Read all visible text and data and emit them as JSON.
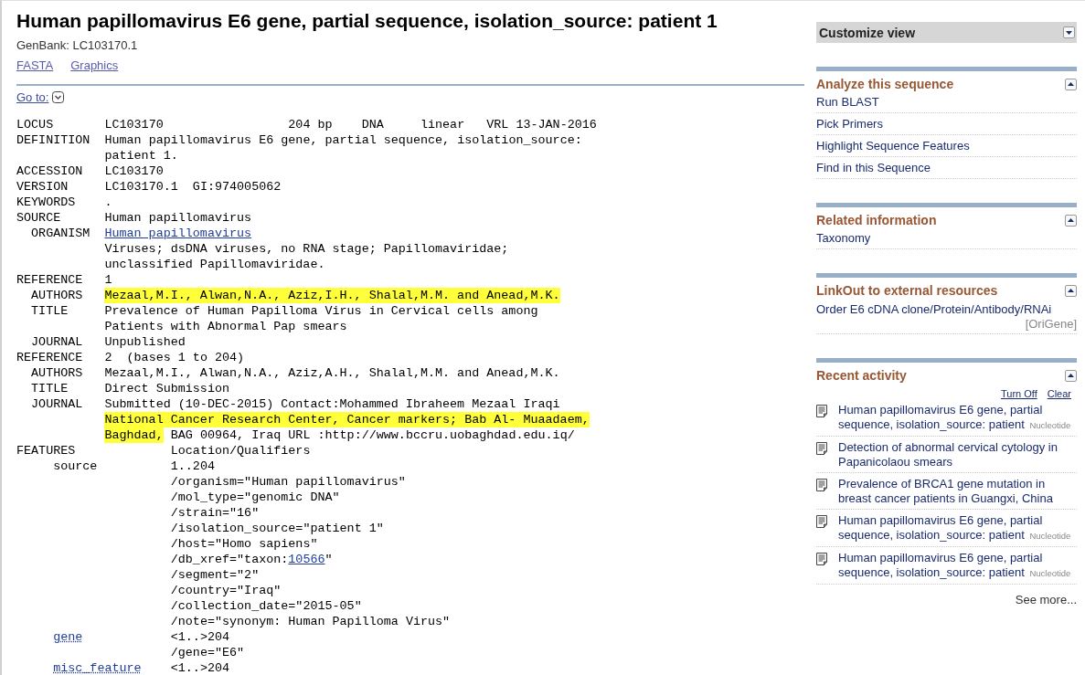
{
  "header": {
    "title": "Human papillomavirus E6 gene, partial sequence, isolation_source: patient 1",
    "accession": "GenBank: LC103170.1",
    "links": [
      "FASTA",
      "Graphics"
    ],
    "goto": "Go to:"
  },
  "records": [
    {
      "label": "LOCUS",
      "lines": [
        "LC103170                 204 bp    DNA     linear   VRL 13-JAN-2016"
      ]
    },
    {
      "label": "DEFINITION",
      "lines": [
        "Human papillomavirus E6 gene, partial sequence, isolation_source:",
        "patient 1."
      ]
    },
    {
      "label": "ACCESSION",
      "lines": [
        "LC103170"
      ]
    },
    {
      "label": "VERSION",
      "lines": [
        "LC103170.1  GI:974005062"
      ]
    },
    {
      "label": "KEYWORDS",
      "lines": [
        "."
      ]
    },
    {
      "label": "SOURCE",
      "lines": [
        "Human papillomavirus"
      ],
      "children": [
        {
          "label": "ORGANISM",
          "lines": [
            [
              {
                "kind": "link",
                "text": "Human papillomavirus"
              }
            ],
            "Viruses; dsDNA viruses, no RNA stage; Papillomaviridae;",
            "unclassified Papillomaviridae."
          ]
        }
      ]
    },
    {
      "label": "REFERENCE",
      "lines": [
        "1"
      ],
      "children": [
        {
          "label": "AUTHORS",
          "lines": [
            [
              {
                "kind": "highlight",
                "text": "Mezaal,M.I., Alwan,N.A., Aziz,I.H., Shalal,M.M. and Anead,M.K."
              }
            ]
          ]
        },
        {
          "label": "TITLE",
          "lines": [
            "Prevalence of Human Papilloma Virus in Cervical cells among",
            "Patients with Abnormal Pap smears"
          ]
        },
        {
          "label": "JOURNAL",
          "lines": [
            "Unpublished"
          ]
        }
      ]
    },
    {
      "label": "REFERENCE",
      "lines": [
        "2  (bases 1 to 204)"
      ],
      "children": [
        {
          "label": "AUTHORS",
          "lines": [
            "Mezaal,M.I., Alwan,N.A., Aziz,A.H., Shalal,M.M. and Anead,M.K."
          ]
        },
        {
          "label": "TITLE",
          "lines": [
            "Direct Submission"
          ]
        },
        {
          "label": "JOURNAL",
          "lines": [
            "Submitted (10-DEC-2015) Contact:Mohammed Ibraheem Mezaal Iraqi",
            [
              {
                "kind": "highlight",
                "text": "National Cancer Research Center, Cancer markers; Bab Al- Muaadaem,"
              }
            ],
            [
              {
                "kind": "highlight",
                "text": "Baghdad,"
              },
              {
                "kind": "plain",
                "text": " BAG 00964, Iraq URL :http://www.bccru.uobaghdad.edu.iq/"
              }
            ]
          ]
        }
      ]
    }
  ],
  "features": {
    "label": "FEATURES",
    "heading": "Location/Qualifiers",
    "items": [
      {
        "key": {
          "text": "source",
          "kind": "plain"
        },
        "lines": [
          "1..204",
          "/organism=\"Human papillomavirus\"",
          "/mol_type=\"genomic DNA\"",
          "/strain=\"16\"",
          "/isolation_source=\"patient 1\"",
          "/host=\"Homo sapiens\"",
          [
            {
              "kind": "plain",
              "text": "/db_xref=\"taxon:"
            },
            {
              "kind": "link",
              "text": "10566"
            },
            {
              "kind": "plain",
              "text": "\""
            }
          ],
          "/segment=\"2\"",
          "/country=\"Iraq\"",
          "/collection_date=\"2015-05\"",
          "/note=\"synonym: Human Papilloma Virus\""
        ]
      },
      {
        "key": {
          "text": "gene",
          "kind": "link"
        },
        "lines": [
          "<1..>204",
          "/gene=\"E6\""
        ]
      },
      {
        "key": {
          "text": "misc_feature",
          "kind": "link"
        },
        "lines": [
          "<1..>204"
        ]
      }
    ]
  },
  "sidebar": {
    "customize": {
      "title": "Customize view",
      "expanded": false
    },
    "portlets": [
      {
        "kind": "links",
        "title": "Analyze this sequence",
        "expanded": true,
        "links": [
          "Run BLAST",
          "Pick Primers",
          "Highlight Sequence Features",
          "Find in this Sequence"
        ]
      },
      {
        "kind": "links",
        "title": "Related information",
        "expanded": true,
        "links": [
          "Taxonomy"
        ]
      },
      {
        "kind": "linkout",
        "title": "LinkOut to external resources",
        "expanded": true,
        "items": [
          {
            "text": "Order E6 cDNA clone/Protein/Antibody/RNAi",
            "source": "[OriGene]"
          }
        ]
      },
      {
        "kind": "activity",
        "title": "Recent activity",
        "expanded": true,
        "controls": [
          "Turn Off",
          "Clear"
        ],
        "items": [
          {
            "title": "Human papillomavirus E6 gene, partial sequence, isolation_source: patient",
            "tag": "Nucleotide"
          },
          {
            "title": "Detection of abnormal cervical cytology in Papanicolaou smears"
          },
          {
            "title": "Prevalence of BRCA1 gene mutation in breast cancer patients in Guangxi, China"
          },
          {
            "title": "Human papillomavirus E6 gene, partial sequence, isolation_source: patient",
            "tag": "Nucleotide"
          },
          {
            "title": "Human papillomavirus E6 gene, partial sequence, isolation_source: patient",
            "tag": "Nucleotide"
          }
        ],
        "more": "See more..."
      }
    ]
  }
}
